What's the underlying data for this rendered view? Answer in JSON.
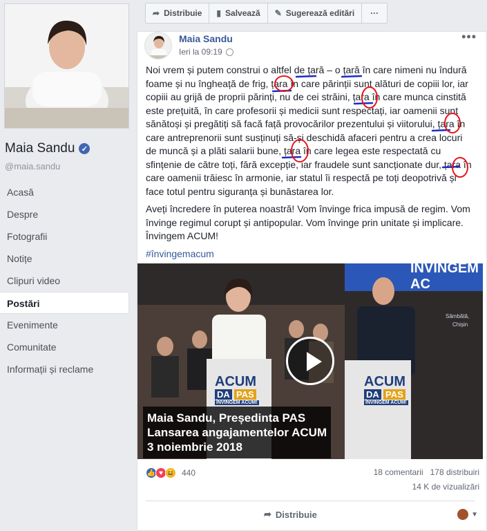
{
  "page": {
    "name": "Maia Sandu",
    "handle": "@maia.sandu",
    "nav": [
      "Acasă",
      "Despre",
      "Fotografii",
      "Notițe",
      "Clipuri video",
      "Postări",
      "Evenimente",
      "Comunitate",
      "Informații și reclame"
    ],
    "active_nav": "Postări"
  },
  "actions": {
    "share": "Distribuie",
    "save": "Salvează",
    "suggest": "Sugerează editări",
    "more": "···"
  },
  "post": {
    "author": "Maia Sandu",
    "time": "Ieri la 09:19",
    "paragraph1": "Noi vrem și putem construi o altfel de țară – o țară în care nimeni nu îndură foame și nu îngheață de frig, țara în care părinții sunt alături de copiii lor, iar copiii au grijă de proprii părinți, nu de cei străini, țara în care munca cinstită este prețuită, în care profesorii și medicii sunt respectați, iar oamenii sunt sănătoși și pregătiți să facă față provocărilor prezentului și viitorului, țara în care antreprenorii sunt susținuți să-și deschidă afaceri pentru a crea locuri de muncă și a plăti salarii bune, țara în care legea este respectată cu sfințenie de către toți, fără excepție, iar fraudele sunt sancționate dur, țara în care oamenii trăiesc în armonie, iar statul îi respectă pe toți deopotrivă și face totul pentru siguranța și bunăstarea lor.",
    "paragraph2": "Aveți încredere în puterea noastră! Vom învinge frica impusă de regim. Vom învinge regimul corupt și antipopular. Vom învinge prin unitate și implicare. Învingem ACUM!",
    "hashtag": "#învingemacum",
    "video": {
      "caption_line1": "Maia Sandu, Președinta PAS",
      "caption_line2": "Lansarea angajamentelor ACUM",
      "caption_line3": "3 noiembrie 2018",
      "banner": "ÎNVINGEM AC",
      "podium_main": "ACUM",
      "podium_sub1": "DA",
      "podium_sub2": "PAS",
      "podium_tag": "ÎNVINGEM ACUM!",
      "side_text1": "Sâmbătă,",
      "side_text2": "Chișin"
    },
    "reaction_count": "440",
    "comments": "18 comentarii",
    "shares": "178 distribuiri",
    "views": "14 K de vizualizări",
    "share_label": "Distribuie"
  },
  "colors": {
    "link": "#385898",
    "annotation_red": "#e8141c",
    "annotation_blue": "#1a2dbf"
  }
}
